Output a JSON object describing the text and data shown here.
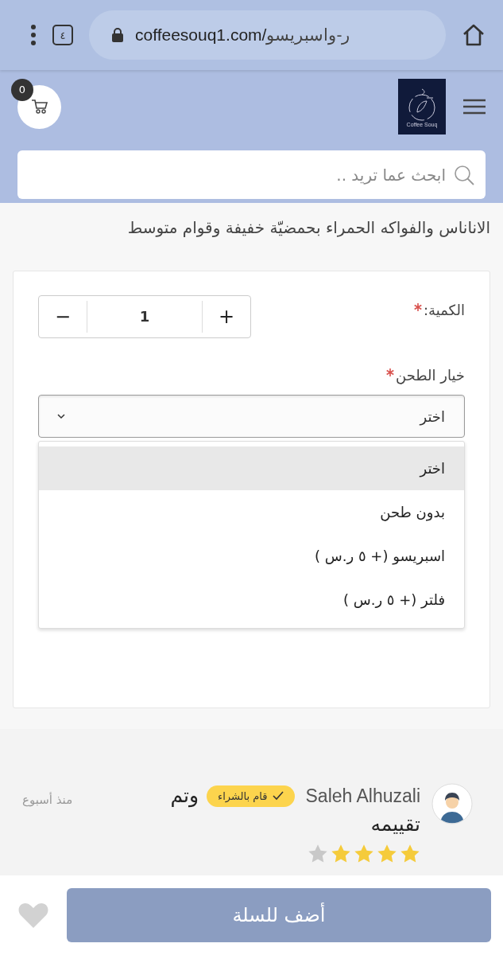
{
  "browser": {
    "url_domain": "coffeesouq1.com/",
    "url_path": "ر-واسبريسو",
    "tab_count": "٤"
  },
  "header": {
    "cart_count": "0",
    "logo_text": "Coffee Souq",
    "search_placeholder": "ابحث عما تريد .."
  },
  "description": {
    "lines": [
      "الاناناس والفواكه الحمراء بحمضيّة خفيفة وقوام متوسط"
    ]
  },
  "product_form": {
    "quantity": {
      "label": "الكمية:",
      "required": true,
      "value": "1",
      "minus": "−",
      "plus": "+"
    },
    "grind": {
      "label": "خيار الطحن",
      "required": true,
      "value": "اختر",
      "expanded": true,
      "options": [
        {
          "label": "اختر",
          "selected": true
        },
        {
          "label": "بدون طحن",
          "selected": false
        },
        {
          "label": "اسبريسو (+ ٥ ر.س )",
          "selected": false
        },
        {
          "label": "فلتر (+ ٥ ر.س )",
          "selected": false
        }
      ]
    }
  },
  "review": {
    "name": "Saleh Alhuzali",
    "badge": "قام بالشراء",
    "text_lines": [
      "وتم",
      "تقييمه"
    ],
    "time": "منذ أسبوع",
    "stars": 4
  },
  "bottom_bar": {
    "add_to_cart": "أضف للسلة",
    "favorite": false
  }
}
